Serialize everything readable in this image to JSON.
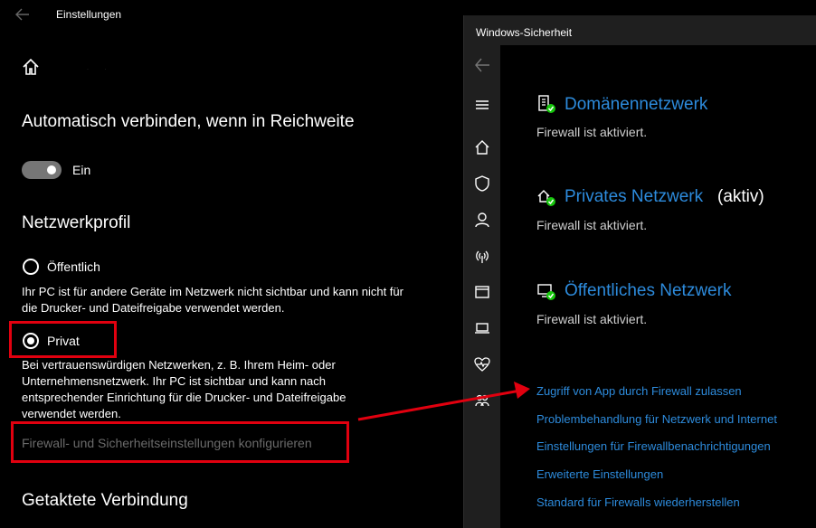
{
  "settings": {
    "title": "Einstellungen",
    "auto_connect_heading": "Automatisch verbinden, wenn in Reichweite",
    "auto_connect_toggle_label": "Ein",
    "profile_heading": "Netzwerkprofil",
    "public_label": "Öffentlich",
    "public_desc": "Ihr PC ist für andere Geräte im Netzwerk nicht sichtbar und kann nicht für die Drucker- und Dateifreigabe verwendet werden.",
    "private_label": "Privat",
    "private_desc": "Bei vertrauenswürdigen Netzwerken, z. B. Ihrem Heim- oder Unternehmensnetzwerk. Ihr PC ist sichtbar und kann nach entsprechender Einrichtung für die Drucker- und Dateifreigabe verwendet werden.",
    "firewall_config_link": "Firewall- und Sicherheitseinstellungen konfigurieren",
    "metered_heading": "Getaktete Verbindung",
    "selected_profile": "Privat"
  },
  "security": {
    "title": "Windows-Sicherheit",
    "networks": [
      {
        "name": "Domänennetzwerk",
        "suffix": "",
        "status": "Firewall ist aktiviert.",
        "icon": "domain-network-icon"
      },
      {
        "name": "Privates Netzwerk",
        "suffix": "(aktiv)",
        "status": "Firewall ist aktiviert.",
        "icon": "private-network-icon"
      },
      {
        "name": "Öffentliches Netzwerk",
        "suffix": "",
        "status": "Firewall ist aktiviert.",
        "icon": "public-network-icon"
      }
    ],
    "links": [
      "Zugriff von App durch Firewall zulassen",
      "Problembehandlung für Netzwerk und Internet",
      "Einstellungen für Firewallbenachrichtigungen",
      "Erweiterte Einstellungen",
      "Standard für Firewalls wiederherstellen"
    ]
  },
  "colors": {
    "accent_link": "#2d8bdc",
    "highlight": "#e1000f",
    "status_ok": "#16c60c"
  }
}
